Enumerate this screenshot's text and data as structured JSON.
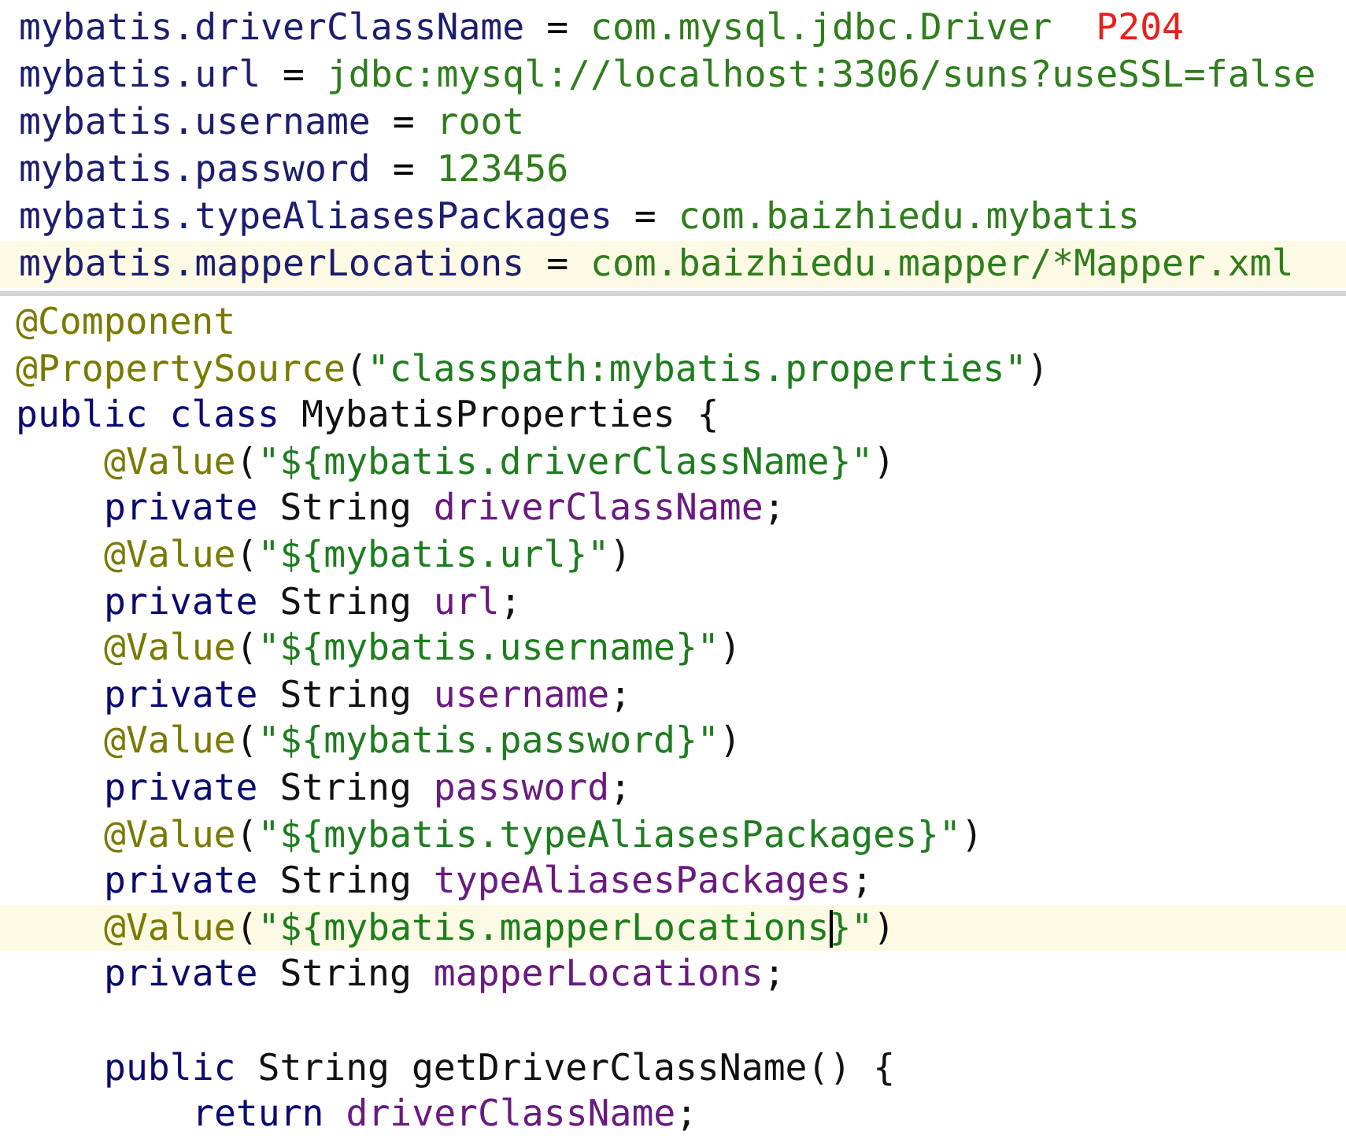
{
  "properties": {
    "lines": [
      {
        "key": "mybatis.driverClassName",
        "separator": "=",
        "value": "com.mysql.jdbc.Driver",
        "note": "P204",
        "current": false
      },
      {
        "key": "mybatis.url",
        "separator": "=",
        "value": "jdbc:mysql://localhost:3306/suns?useSSL=false",
        "current": false
      },
      {
        "key": "mybatis.username",
        "separator": "=",
        "value": "root",
        "current": false
      },
      {
        "key": "mybatis.password",
        "separator": "=",
        "value": "123456",
        "current": false
      },
      {
        "key": "mybatis.typeAliasesPackages",
        "separator": "=",
        "value": "com.baizhiedu.mybatis",
        "current": false
      },
      {
        "key": "mybatis.mapperLocations",
        "separator": "=",
        "value": "com.baizhiedu.mapper/*Mapper.xml",
        "current": true
      }
    ]
  },
  "editor": {
    "lines": [
      {
        "current": false,
        "tokens": [
          {
            "kind": "annotation",
            "text": "@Component"
          }
        ]
      },
      {
        "current": false,
        "tokens": [
          {
            "kind": "annotation",
            "text": "@PropertySource"
          },
          {
            "kind": "plain",
            "text": "("
          },
          {
            "kind": "string",
            "text": "\"classpath:mybatis.properties\""
          },
          {
            "kind": "plain",
            "text": ")"
          }
        ]
      },
      {
        "current": false,
        "tokens": [
          {
            "kind": "keyword",
            "text": "public class "
          },
          {
            "kind": "plain",
            "text": "MybatisProperties {"
          }
        ],
        "children": [
          {
            "current": false,
            "tokens": [
              {
                "kind": "annotation",
                "text": "@Value"
              },
              {
                "kind": "plain",
                "text": "("
              },
              {
                "kind": "string",
                "text": "\"${mybatis.driverClassName}\""
              },
              {
                "kind": "plain",
                "text": ")"
              }
            ]
          },
          {
            "current": false,
            "tokens": [
              {
                "kind": "keyword",
                "text": "private "
              },
              {
                "kind": "plain",
                "text": "String "
              },
              {
                "kind": "field",
                "text": "driverClassName"
              },
              {
                "kind": "plain",
                "text": ";"
              }
            ]
          },
          {
            "current": false,
            "tokens": [
              {
                "kind": "annotation",
                "text": "@Value"
              },
              {
                "kind": "plain",
                "text": "("
              },
              {
                "kind": "string",
                "text": "\"${mybatis.url}\""
              },
              {
                "kind": "plain",
                "text": ")"
              }
            ]
          },
          {
            "current": false,
            "tokens": [
              {
                "kind": "keyword",
                "text": "private "
              },
              {
                "kind": "plain",
                "text": "String "
              },
              {
                "kind": "field",
                "text": "url"
              },
              {
                "kind": "plain",
                "text": ";"
              }
            ]
          },
          {
            "current": false,
            "tokens": [
              {
                "kind": "annotation",
                "text": "@Value"
              },
              {
                "kind": "plain",
                "text": "("
              },
              {
                "kind": "string",
                "text": "\"${mybatis.username}\""
              },
              {
                "kind": "plain",
                "text": ")"
              }
            ]
          },
          {
            "current": false,
            "tokens": [
              {
                "kind": "keyword",
                "text": "private "
              },
              {
                "kind": "plain",
                "text": "String "
              },
              {
                "kind": "field",
                "text": "username"
              },
              {
                "kind": "plain",
                "text": ";"
              }
            ]
          },
          {
            "current": false,
            "tokens": [
              {
                "kind": "annotation",
                "text": "@Value"
              },
              {
                "kind": "plain",
                "text": "("
              },
              {
                "kind": "string",
                "text": "\"${mybatis.password}\""
              },
              {
                "kind": "plain",
                "text": ")"
              }
            ]
          },
          {
            "current": false,
            "tokens": [
              {
                "kind": "keyword",
                "text": "private "
              },
              {
                "kind": "plain",
                "text": "String "
              },
              {
                "kind": "field",
                "text": "password"
              },
              {
                "kind": "plain",
                "text": ";"
              }
            ]
          },
          {
            "current": false,
            "tokens": [
              {
                "kind": "annotation",
                "text": "@Value"
              },
              {
                "kind": "plain",
                "text": "("
              },
              {
                "kind": "string",
                "text": "\"${mybatis.typeAliasesPackages}\""
              },
              {
                "kind": "plain",
                "text": ")"
              }
            ]
          },
          {
            "current": false,
            "tokens": [
              {
                "kind": "keyword",
                "text": "private "
              },
              {
                "kind": "plain",
                "text": "String "
              },
              {
                "kind": "field",
                "text": "typeAliasesPackages"
              },
              {
                "kind": "plain",
                "text": ";"
              }
            ]
          },
          {
            "current": true,
            "tokens": [
              {
                "kind": "annotation",
                "text": "@Value"
              },
              {
                "kind": "plain",
                "text": "("
              },
              {
                "kind": "string",
                "text": "\"${mybatis.mapperLocations"
              },
              {
                "kind": "caret"
              },
              {
                "kind": "string",
                "text": "}\""
              },
              {
                "kind": "plain",
                "text": ")"
              }
            ]
          },
          {
            "current": false,
            "tokens": [
              {
                "kind": "keyword",
                "text": "private "
              },
              {
                "kind": "plain",
                "text": "String "
              },
              {
                "kind": "field",
                "text": "mapperLocations"
              },
              {
                "kind": "plain",
                "text": ";"
              }
            ]
          },
          {
            "current": false
          },
          {
            "current": false,
            "tokens": [
              {
                "kind": "keyword",
                "text": "public "
              },
              {
                "kind": "plain",
                "text": "String getDriverClassName() {"
              }
            ],
            "children": [
              {
                "current": false,
                "tokens": [
                  {
                    "kind": "keyword",
                    "text": "return "
                  },
                  {
                    "kind": "field",
                    "text": "driverClassName"
                  },
                  {
                    "kind": "plain",
                    "text": ";"
                  }
                ]
              }
            ]
          }
        ]
      }
    ]
  }
}
